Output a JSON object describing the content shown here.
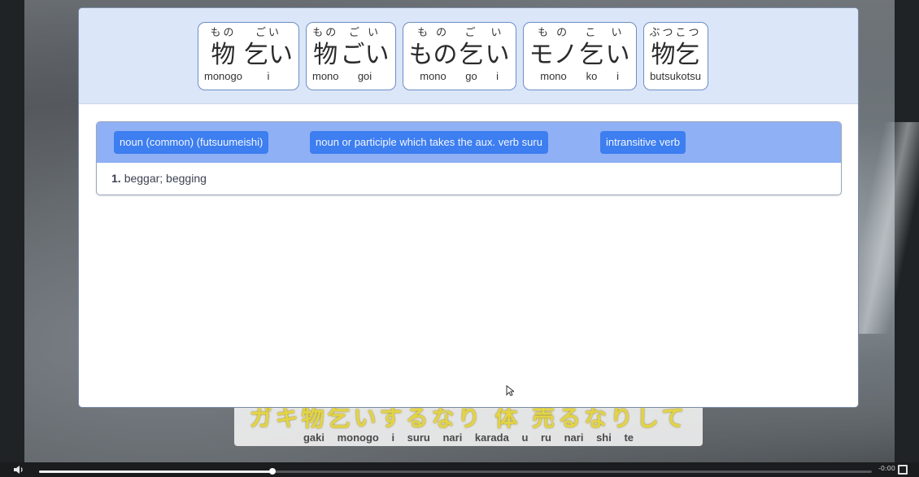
{
  "popup": {
    "variants": [
      {
        "segments": [
          {
            "furigana": "もの",
            "text": "物",
            "romaji": "monogo"
          },
          {
            "furigana": "ごい",
            "text": "乞い",
            "romaji": "i"
          }
        ]
      },
      {
        "segments": [
          {
            "furigana": "もの",
            "text": "物",
            "romaji": "mono"
          },
          {
            "furigana": "ご い",
            "text": "ごい",
            "romaji": "goi"
          }
        ]
      },
      {
        "segments": [
          {
            "furigana": "も の",
            "text": "もの",
            "romaji": "mono"
          },
          {
            "furigana": "ご",
            "text": "乞",
            "romaji": "go"
          },
          {
            "furigana": "い",
            "text": "い",
            "romaji": "i"
          }
        ]
      },
      {
        "segments": [
          {
            "furigana": "も の",
            "text": "モノ",
            "romaji": "mono"
          },
          {
            "furigana": "こ",
            "text": "乞",
            "romaji": "ko"
          },
          {
            "furigana": "い",
            "text": "い",
            "romaji": "i"
          }
        ]
      },
      {
        "segments": [
          {
            "furigana": "ぶつこつ",
            "text": "物乞",
            "romaji": "butsukotsu"
          }
        ]
      }
    ],
    "sense": {
      "pos_tags": [
        "noun (common) (futsuumeishi)",
        "noun or participle which takes the aux. verb suru",
        "intransitive verb"
      ],
      "gloss_number": "1.",
      "gloss_text": "beggar; begging"
    }
  },
  "subtitle": {
    "japanese": "ガキ物乞いするなり 体 売るなりして",
    "romaji": "gaki monogo i suru nari karada u ru nari shi te"
  },
  "player": {
    "time": "-0:00",
    "progress": 0.28
  },
  "colors": {
    "accent": "#3d7ef0",
    "header_bg": "#dbe6f8",
    "pos_bar_bg": "#8fb0f4",
    "subtitle_text": "#e4d444"
  }
}
